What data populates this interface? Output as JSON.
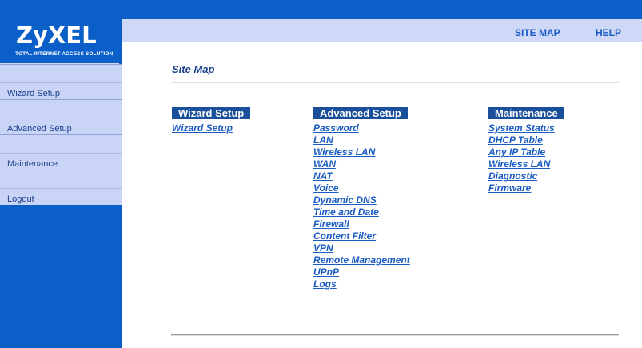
{
  "logo": {
    "brand": "ZyXEL",
    "tagline": "TOTAL INTERNET ACCESS SOLUTION"
  },
  "header": {
    "site_map": "SITE MAP",
    "help": "HELP"
  },
  "sidebar": {
    "items": [
      {
        "label": "Wizard Setup"
      },
      {
        "label": "Advanced Setup"
      },
      {
        "label": "Maintenance"
      },
      {
        "label": "Logout"
      }
    ]
  },
  "page": {
    "title": "Site Map"
  },
  "columns": [
    {
      "heading": "Wizard Setup",
      "links": [
        "Wizard Setup"
      ]
    },
    {
      "heading": "Advanced Setup",
      "links": [
        "Password",
        "LAN",
        "Wireless LAN",
        "WAN",
        "NAT",
        "Voice",
        "Dynamic DNS",
        "Time and Date",
        "Firewall",
        "Content Filter",
        "VPN",
        "Remote Management",
        "UPnP",
        "Logs"
      ]
    },
    {
      "heading": "Maintenance",
      "links": [
        "System Status",
        "DHCP Table",
        "Any IP Table",
        "Wireless LAN",
        "Diagnostic",
        "Firmware"
      ]
    }
  ],
  "colors": {
    "sidebar_blue": "#0a5fc9",
    "nav_light": "#c9d4f6",
    "link_blue": "#1a5cc4",
    "heading_bg": "#1a4f9c"
  }
}
